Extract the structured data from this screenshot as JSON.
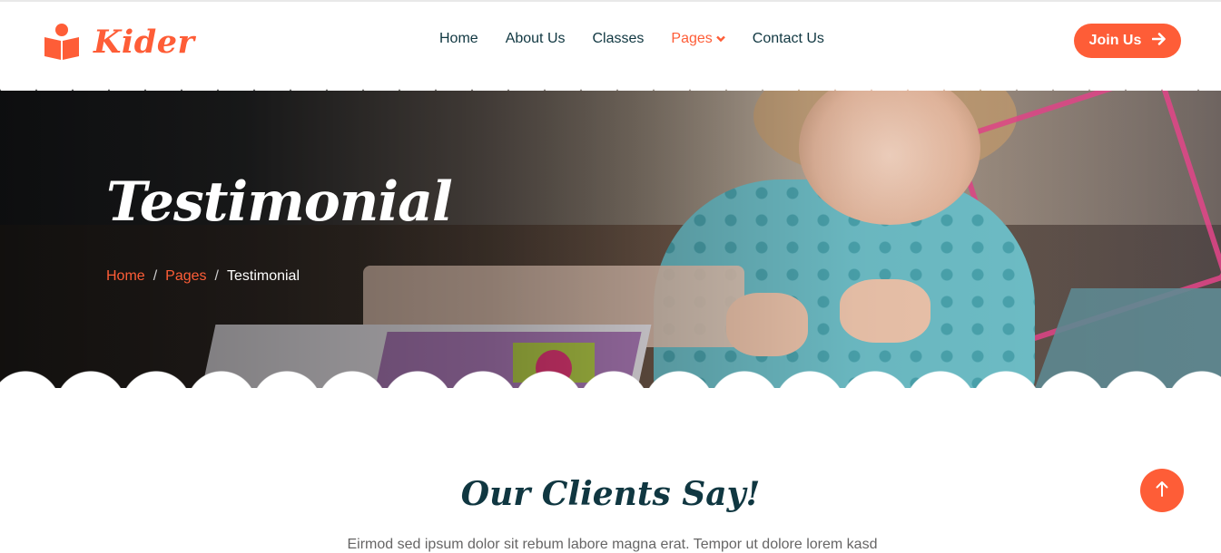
{
  "brand": {
    "name": "Kider",
    "icon": "book-reader-icon",
    "accent_color": "#fe5d37"
  },
  "nav": {
    "items": [
      {
        "label": "Home",
        "active": false
      },
      {
        "label": "About Us",
        "active": false
      },
      {
        "label": "Classes",
        "active": false
      },
      {
        "label": "Pages",
        "active": true,
        "dropdown": true
      },
      {
        "label": "Contact Us",
        "active": false
      }
    ],
    "join_label": "Join Us",
    "join_icon": "arrow-right-icon"
  },
  "hero": {
    "title": "Testimonial",
    "breadcrumb": {
      "home": "Home",
      "pages": "Pages",
      "current": "Testimonial",
      "separator": "/"
    }
  },
  "section": {
    "title": "Our Clients Say!",
    "subtitle": "Eirmod sed ipsum dolor sit rebum labore magna erat. Tempor ut dolore lorem kasd"
  },
  "back_to_top": {
    "icon": "arrow-up-icon"
  },
  "colors": {
    "primary": "#fe5d37",
    "dark": "#103741",
    "text": "#666565"
  }
}
